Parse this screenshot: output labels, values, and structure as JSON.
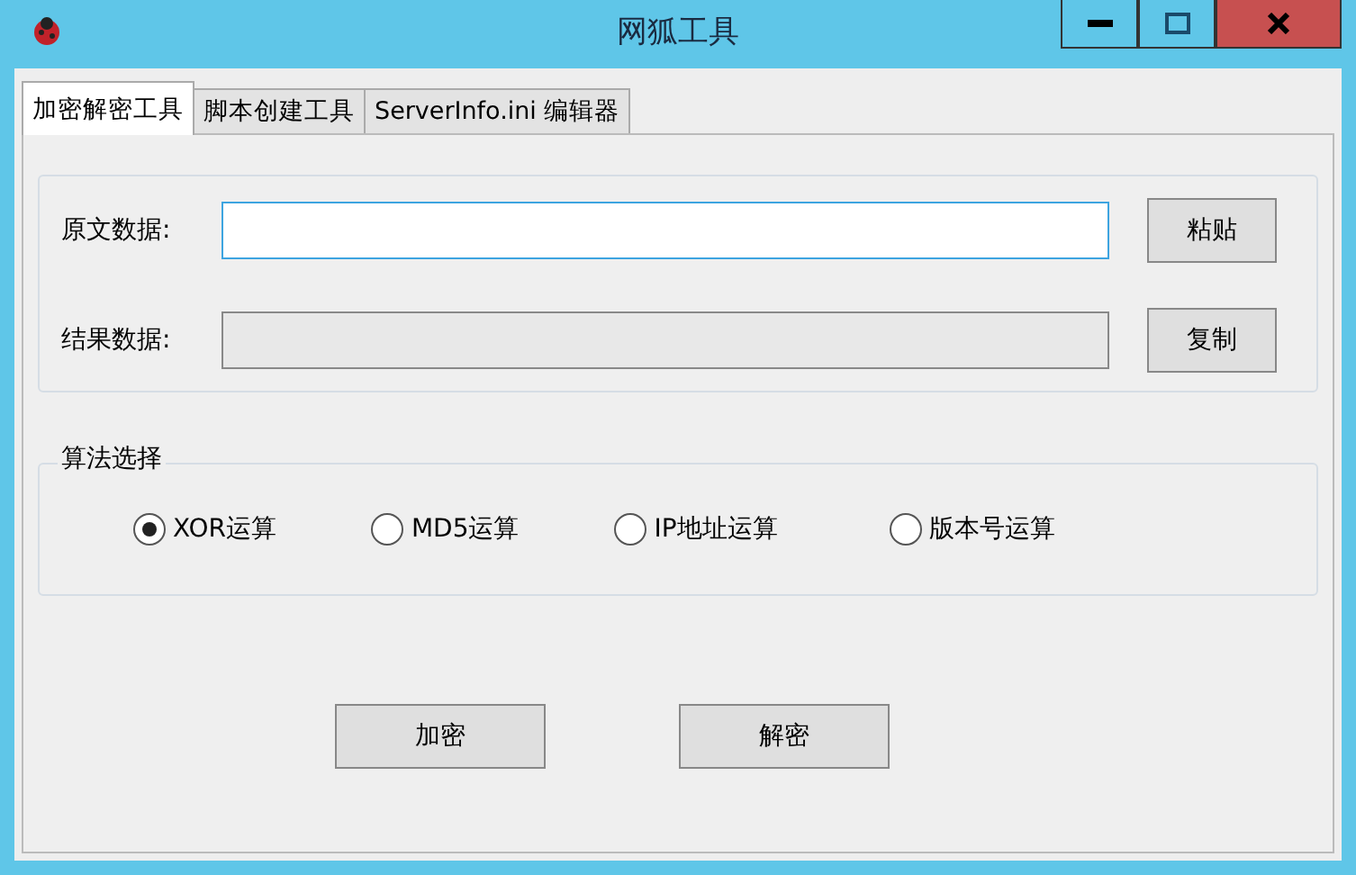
{
  "window": {
    "title": "网狐工具"
  },
  "tabs": [
    {
      "label": "加密解密工具",
      "selected": true
    },
    {
      "label": "脚本创建工具",
      "selected": false
    },
    {
      "label": "ServerInfo.ini 编辑器",
      "selected": false
    }
  ],
  "fields": [
    {
      "label": "原文数据:",
      "focused": true,
      "readonly": false,
      "button": "粘贴"
    },
    {
      "label": "结果数据:",
      "focused": false,
      "readonly": true,
      "button": "复制"
    }
  ],
  "algorithm": {
    "legend": "算法选择",
    "options": [
      {
        "label": "XOR运算",
        "selected": true
      },
      {
        "label": "MD5运算",
        "selected": false
      },
      {
        "label": "IP地址运算",
        "selected": false
      },
      {
        "label": "版本号运算",
        "selected": false
      }
    ]
  },
  "buttons": [
    "加密",
    "解密"
  ]
}
